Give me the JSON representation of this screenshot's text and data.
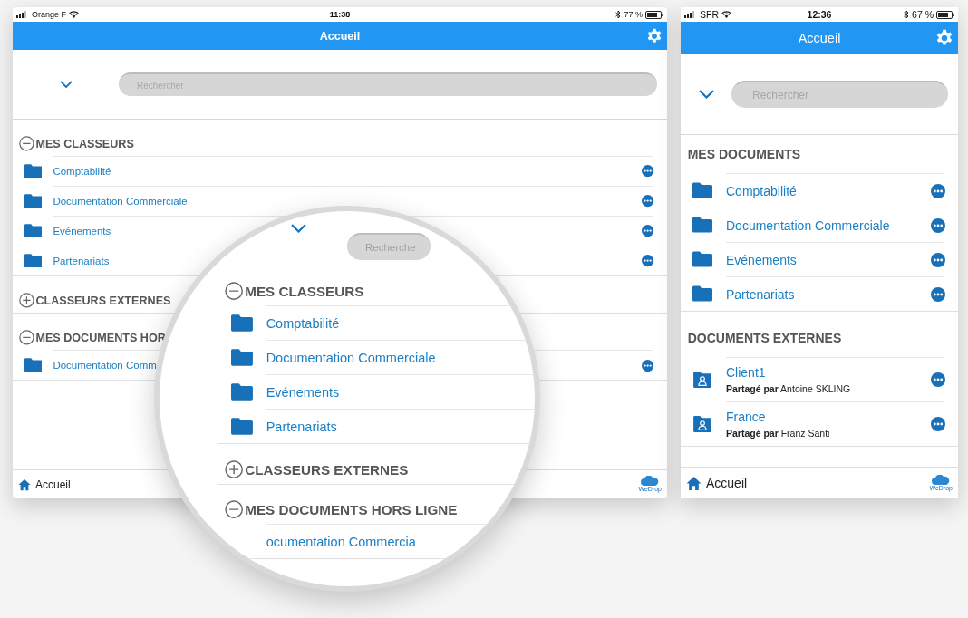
{
  "tablet": {
    "status_bar": {
      "carrier": "Orange F",
      "time": "11:38",
      "battery": "77 %"
    },
    "title": "Accueil",
    "search": {
      "placeholder": "Rechercher"
    },
    "sections": [
      {
        "title": "MES CLASSEURS",
        "expanded": true,
        "items": [
          {
            "label": "Comptabilité"
          },
          {
            "label": "Documentation Commerciale"
          },
          {
            "label": "Evénements"
          },
          {
            "label": "Partenariats"
          }
        ]
      },
      {
        "title": "CLASSEURS EXTERNES",
        "expanded": false
      },
      {
        "title": "MES DOCUMENTS HOR",
        "expanded": true,
        "items": [
          {
            "label": "Documentation Comm"
          }
        ]
      }
    ],
    "tab_bar": {
      "label": "Accueil",
      "logo": "WeDrop"
    }
  },
  "magnifier": {
    "search": {
      "placeholder": "Recherche"
    },
    "sections": [
      {
        "title": "MES CLASSEURS",
        "expanded": true,
        "items": [
          {
            "label": "Comptabilité"
          },
          {
            "label": "Documentation Commerciale"
          },
          {
            "label": "Evénements"
          },
          {
            "label": "Partenariats"
          }
        ]
      },
      {
        "title": "CLASSEURS EXTERNES",
        "expanded": false
      },
      {
        "title": "MES DOCUMENTS HORS LIGNE",
        "expanded": true,
        "items": [
          {
            "kind": "text_only",
            "label": "ocumentation Commercia"
          }
        ]
      }
    ]
  },
  "phone": {
    "status_bar": {
      "carrier": "SFR",
      "time": "12:36",
      "battery": "67 %"
    },
    "title": "Accueil",
    "search": {
      "placeholder": "Rechercher"
    },
    "sections": [
      {
        "title": "MES DOCUMENTS",
        "items": [
          {
            "kind": "folder",
            "label": "Comptabilité"
          },
          {
            "kind": "folder",
            "label": "Documentation Commerciale"
          },
          {
            "kind": "folder",
            "label": "Evénements"
          },
          {
            "kind": "folder",
            "label": "Partenariats"
          }
        ]
      },
      {
        "title": "DOCUMENTS EXTERNES",
        "items": [
          {
            "kind": "shared",
            "label": "Client1",
            "subtitle": "**Partagé par** Antoine SKLING"
          },
          {
            "kind": "shared",
            "label": "France",
            "subtitle": "**Partagé par** Franz Santi"
          }
        ]
      }
    ],
    "tab_bar": {
      "label": "Accueil",
      "logo": "WeDrop"
    }
  }
}
